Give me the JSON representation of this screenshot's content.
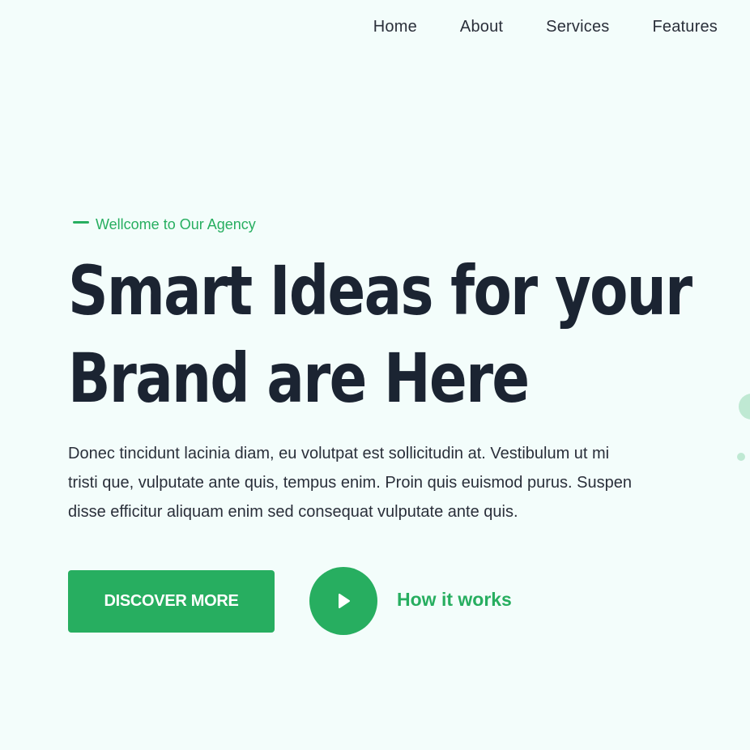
{
  "nav": {
    "items": [
      {
        "label": "Home"
      },
      {
        "label": "About"
      },
      {
        "label": "Services"
      },
      {
        "label": "Features"
      }
    ]
  },
  "hero": {
    "eyebrow": "Wellcome to Our Agency",
    "headline_line1": "Smart Ideas for your",
    "headline_line2": "Brand are Here",
    "description_line1": "Donec tincidunt lacinia diam, eu volutpat est sollicitudin at. Vestibulum ut mi",
    "description_line2": "tristi que, vulputate ante quis, tempus enim. Proin quis euismod purus. Suspen",
    "description_line3": "disse efficitur aliquam enim sed consequat vulputate ante quis.",
    "primary_button": "DISCOVER MORE",
    "secondary_link": "How it works",
    "play_icon": "play-icon"
  },
  "colors": {
    "accent": "#27ae60",
    "background": "#f3fdfb",
    "heading": "#1b2432",
    "decor": "#bfe9d3"
  }
}
